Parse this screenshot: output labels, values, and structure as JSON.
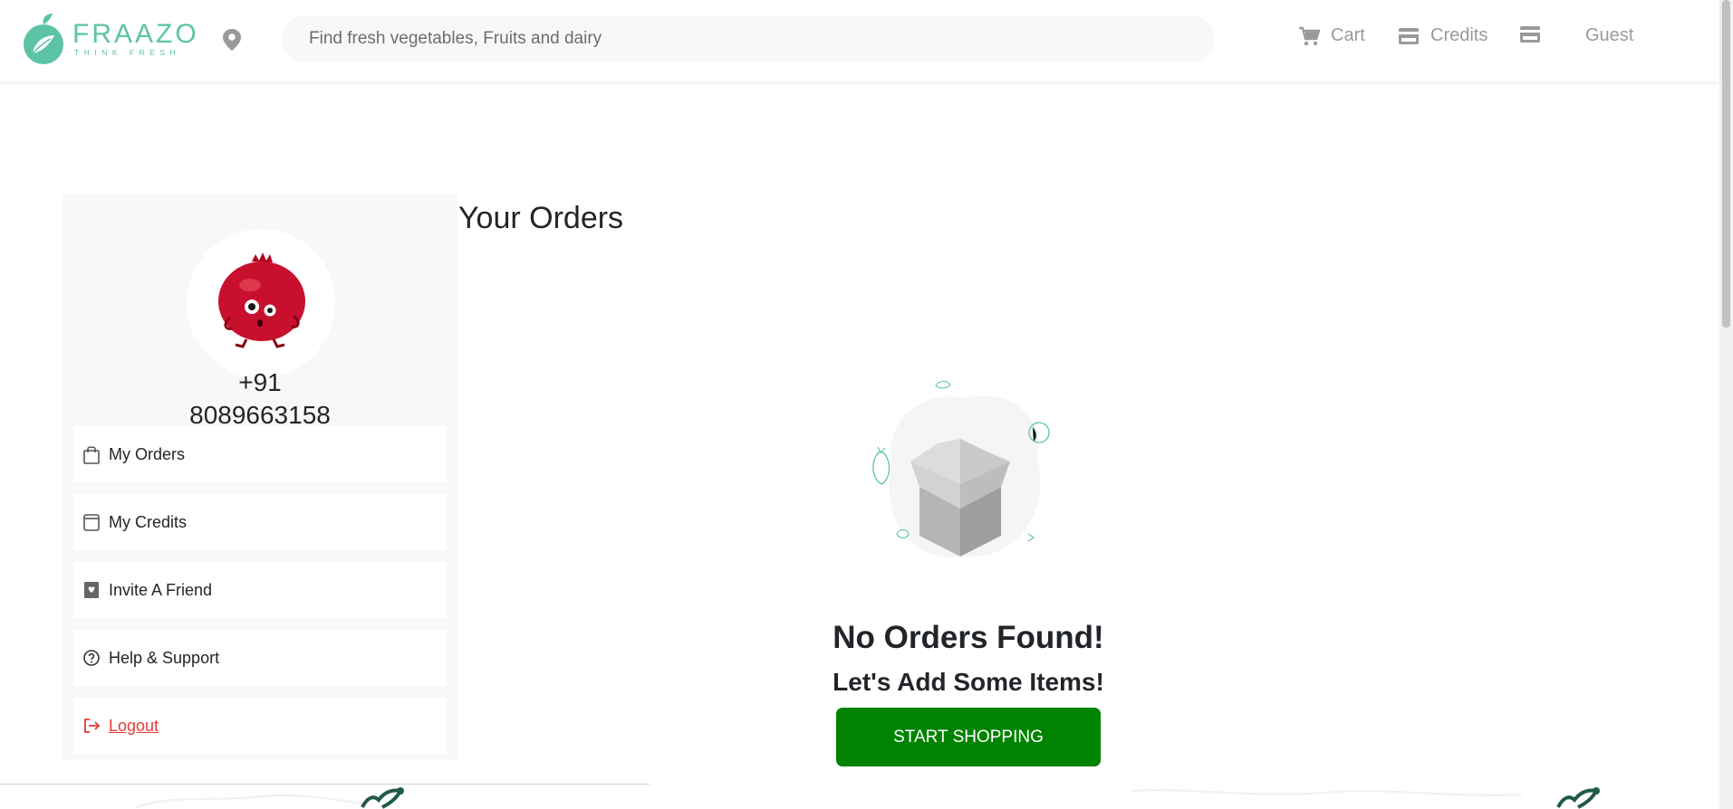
{
  "header": {
    "logo_name": "FRAAZO",
    "logo_tagline": "THINK FRESH",
    "search_placeholder": "Find fresh vegetables, Fruits and dairy",
    "nav": {
      "cart_label": "Cart",
      "credits_label": "Credits",
      "guest_label": "Guest"
    }
  },
  "sidebar": {
    "phone_line1": "+91",
    "phone_line2": "8089663158",
    "menu": [
      {
        "label": "My Orders",
        "icon": "bag-icon"
      },
      {
        "label": "My Credits",
        "icon": "wallet-icon"
      },
      {
        "label": "Invite A Friend",
        "icon": "invite-icon"
      },
      {
        "label": "Help & Support",
        "icon": "help-icon"
      },
      {
        "label": "Logout",
        "icon": "logout-icon"
      }
    ]
  },
  "main": {
    "title": "Your Orders",
    "empty_title": "No Orders Found!",
    "empty_subtitle": "Let's Add Some Items!",
    "cta_label": "START SHOPPING"
  },
  "colors": {
    "brand": "#5cc3a6",
    "cta": "#008300",
    "logout": "#e53935",
    "nav_text": "#9a9a9a"
  }
}
